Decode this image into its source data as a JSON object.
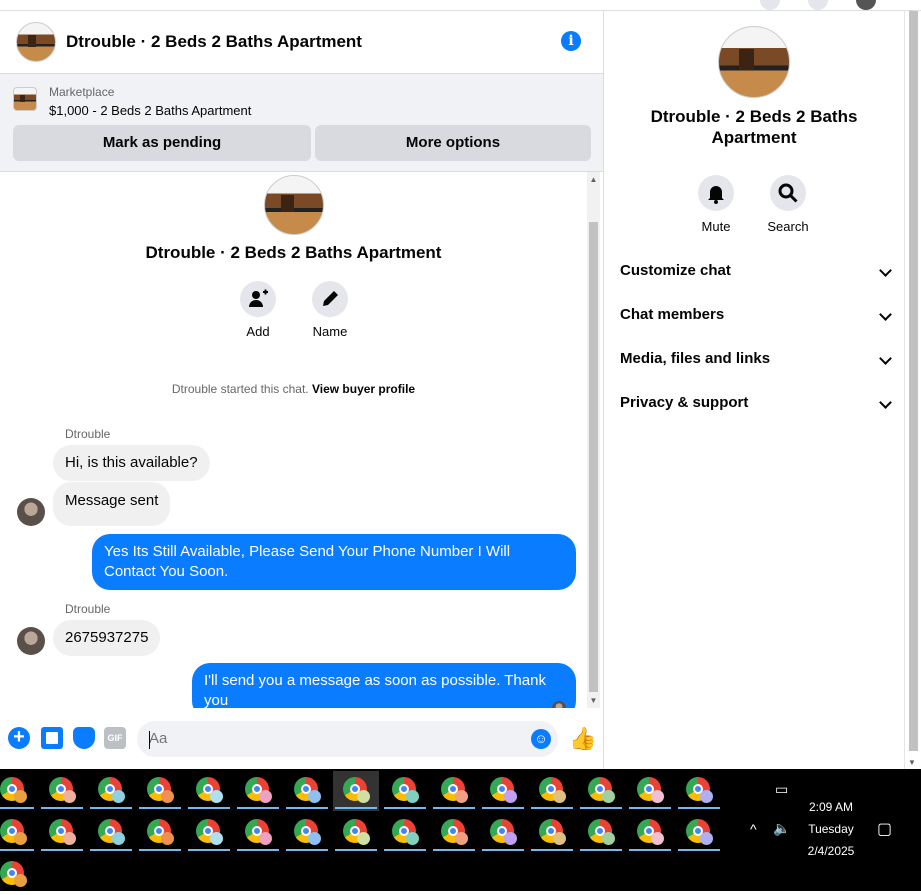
{
  "header": {
    "title": "Dtrouble · 2 Beds 2 Baths Apartment",
    "info_icon": "i"
  },
  "marketplace": {
    "label": "Marketplace",
    "item": "$1,000 - 2 Beds 2 Baths Apartment",
    "pending_button": "Mark as pending",
    "more_button": "More options"
  },
  "intro": {
    "title": "Dtrouble · 2 Beds 2 Baths Apartment",
    "add_label": "Add",
    "name_label": "Name",
    "started_text": "Dtrouble started this chat.",
    "buyer_profile_link": "View buyer profile"
  },
  "messages": [
    {
      "sender": "Dtrouble",
      "text": "Hi, is this available?",
      "direction": "in"
    },
    {
      "text": "Message sent",
      "direction": "in"
    },
    {
      "text": "Yes Its Still Available, Please Send Your Phone Number I Will Contact You Soon.",
      "direction": "out"
    },
    {
      "sender": "Dtrouble",
      "text": "2675937275",
      "direction": "in"
    },
    {
      "text": "I'll send you a message as soon as possible. Thank you",
      "direction": "out"
    }
  ],
  "composer": {
    "placeholder": "Aa",
    "gif_label": "GIF"
  },
  "side": {
    "title": "Dtrouble · 2 Beds 2 Baths Apartment",
    "mute_label": "Mute",
    "search_label": "Search",
    "menu": [
      "Customize chat",
      "Chat members",
      "Media, files and links",
      "Privacy & support"
    ]
  },
  "taskbar": {
    "time": "2:09 AM",
    "day": "Tuesday",
    "date": "2/4/2025"
  },
  "colors": {
    "accent": "#0a7cff",
    "bubble_in": "#f0f0f0",
    "panel": "#f0f2f5"
  }
}
